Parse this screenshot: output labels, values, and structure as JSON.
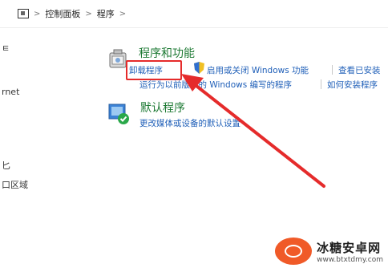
{
  "breadcrumb": {
    "items": [
      "控制面板",
      "程序"
    ],
    "separator": ">"
  },
  "left_panel": {
    "fragments": [
      "ㅌ",
      "rnet",
      "匕",
      "口区域"
    ]
  },
  "programs_features": {
    "title": "程序和功能",
    "links": [
      "卸载程序",
      "启用或关闭 Windows 功能",
      "查看已安装",
      "运行为以前版本的 Windows 编写的程序",
      "如何安装程序"
    ]
  },
  "default_programs": {
    "title": "默认程序",
    "links": [
      "更改媒体或设备的默认设置"
    ]
  },
  "watermark": {
    "name": "冰糖安卓网",
    "url": "www.btxtdmy.com"
  },
  "colors": {
    "link": "#1f5fb8",
    "title": "#1e7a34",
    "annotation": "#e52b2b"
  }
}
